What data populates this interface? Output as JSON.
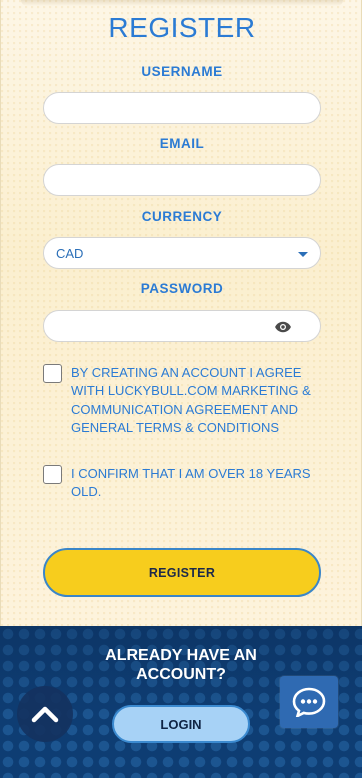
{
  "form": {
    "title": "REGISTER",
    "username_label": "USERNAME",
    "email_label": "EMAIL",
    "currency_label": "CURRENCY",
    "currency_value": "CAD",
    "password_label": "PASSWORD",
    "username_value": "",
    "email_value": "",
    "password_value": "",
    "terms_text": "BY CREATING AN ACCOUNT I AGREE WITH LUCKYBULL.COM MARKETING & COMMUNICATION AGREEMENT AND GENERAL TERMS & CONDITIONS",
    "age_text": "I CONFIRM THAT I AM OVER 18 YEARS OLD.",
    "register_label": "REGISTER"
  },
  "footer": {
    "already_line1": "ALREADY HAVE AN",
    "already_line2": "ACCOUNT?",
    "login_label": "LOGIN"
  },
  "icons": {
    "password_toggle": "eye-icon",
    "scroll_top": "chevron-up-icon",
    "chat": "chat-bubble-icon",
    "currency_dropdown": "caret-down-icon"
  },
  "colors": {
    "accent": "#2b7bd4",
    "register_button": "#f7cd1d",
    "login_button": "#a7d2f6",
    "footer_bg": "#0e3d73"
  }
}
